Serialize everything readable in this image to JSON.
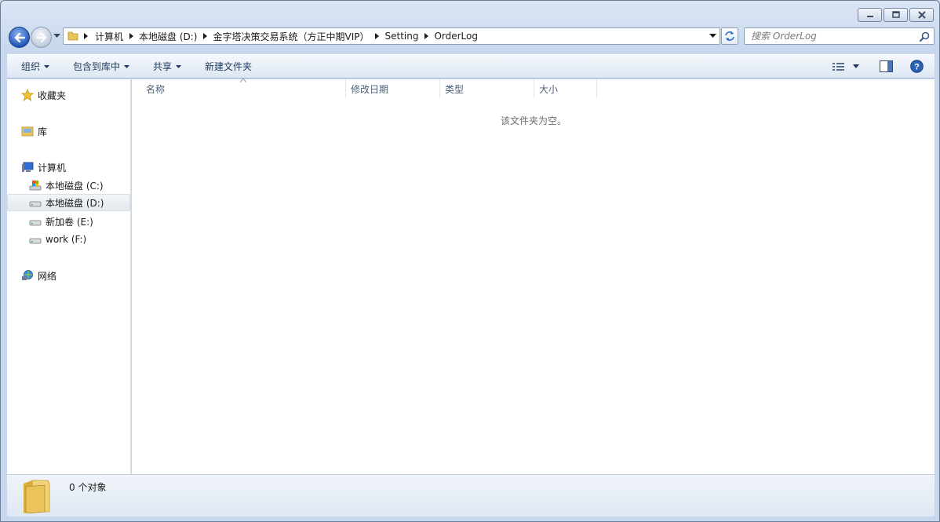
{
  "window": {
    "caption": {
      "minimize_icon": "minimize-icon",
      "maximize_icon": "restore-icon",
      "close_icon": "close-icon"
    }
  },
  "address": {
    "crumbs": [
      "计算机",
      "本地磁盘 (D:)",
      "金字塔决策交易系统（方正中期VIP）",
      "Setting",
      "OrderLog"
    ]
  },
  "search": {
    "placeholder": "搜索 OrderLog"
  },
  "command_bar": {
    "organize": "组织",
    "include_in_library": "包含到库中",
    "share": "共享",
    "new_folder": "新建文件夹"
  },
  "nav": {
    "favorites": "收藏夹",
    "libraries": "库",
    "computer": "计算机",
    "drives": [
      {
        "label": "本地磁盘 (C:)",
        "selected": false
      },
      {
        "label": "本地磁盘 (D:)",
        "selected": true
      },
      {
        "label": "新加卷 (E:)",
        "selected": false
      },
      {
        "label": "work (F:)",
        "selected": false
      }
    ],
    "network": "网络"
  },
  "columns": {
    "name": "名称",
    "date_modified": "修改日期",
    "type": "类型",
    "size": "大小"
  },
  "content": {
    "empty_message": "该文件夹为空。"
  },
  "details": {
    "count_text": "0 个对象"
  },
  "colors": {
    "accent": "#2458b8",
    "frame": "#c6d6ec",
    "folder": "#e8c55a"
  }
}
